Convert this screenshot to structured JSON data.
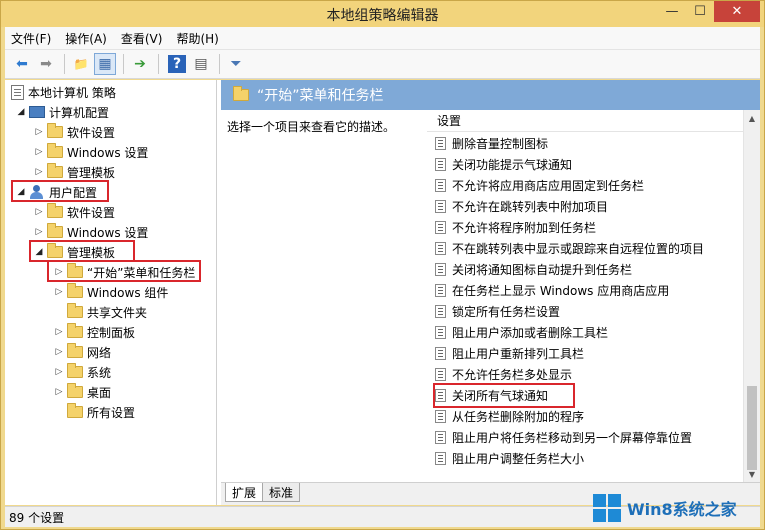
{
  "window": {
    "title": "本地组策略编辑器",
    "minimize": "—",
    "maximize": "☐",
    "close": "✕"
  },
  "menu": [
    "文件(F)",
    "操作(A)",
    "查看(V)",
    "帮助(H)"
  ],
  "toolbar": {
    "icons": [
      "back-arrow-icon",
      "forward-arrow-icon",
      "up-folder-icon",
      "show-tree-icon",
      "export-icon",
      "help-icon",
      "properties-icon",
      "filter-icon"
    ],
    "glyphs": [
      "⬅",
      "➡",
      "📁",
      "▦",
      "➔",
      "?",
      "▤",
      "⏷"
    ]
  },
  "tree": {
    "root": "本地计算机 策略",
    "computer_config": "计算机配置",
    "user_config": "用户配置",
    "software_settings": "软件设置",
    "windows_settings": "Windows 设置",
    "admin_templates": "管理模板",
    "start_menu_taskbar": "“开始”菜单和任务栏",
    "windows_components": "Windows 组件",
    "shared_folders": "共享文件夹",
    "control_panel": "控制面板",
    "network": "网络",
    "system": "系统",
    "desktop": "桌面",
    "all_settings": "所有设置"
  },
  "right": {
    "header": "“开始”菜单和任务栏",
    "description": "选择一个项目来查看它的描述。",
    "column_header": "设置",
    "items": [
      "删除音量控制图标",
      "关闭功能提示气球通知",
      "不允许将应用商店应用固定到任务栏",
      "不允许在跳转列表中附加项目",
      "不允许将程序附加到任务栏",
      "不在跳转列表中显示或跟踪来自远程位置的项目",
      "关闭将通知图标自动提升到任务栏",
      "在任务栏上显示 Windows 应用商店应用",
      "锁定所有任务栏设置",
      "阻止用户添加或者删除工具栏",
      "阻止用户重新排列工具栏",
      "不允许任务栏多处显示",
      "关闭所有气球通知",
      "从任务栏删除附加的程序",
      "阻止用户将任务栏移动到另一个屏幕停靠位置",
      "阻止用户调整任务栏大小"
    ]
  },
  "tabs": [
    "扩展",
    "标准"
  ],
  "status": "89 个设置",
  "watermark": "Win8系统之家",
  "colors": {
    "accent": "#7fa9d7",
    "highlight_box": "#d9262c",
    "title_bar": "#f2d47c"
  }
}
